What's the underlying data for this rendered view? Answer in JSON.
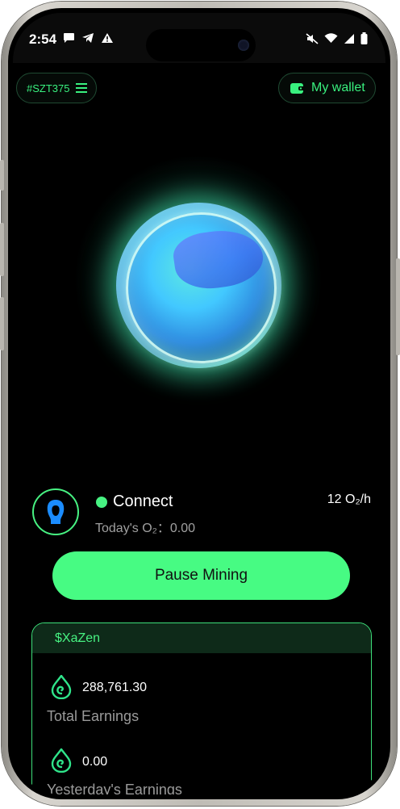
{
  "status_bar": {
    "time": "2:54"
  },
  "header": {
    "user_id": "#SZT375",
    "wallet_label": "My wallet"
  },
  "mining": {
    "status": "Connect",
    "today_label": "Today's O₂：",
    "today_value": "0.00",
    "rate": "12 O₂/h",
    "pause_label": "Pause Mining"
  },
  "earnings": {
    "token": "$XaZen",
    "total_value": "288,761.30",
    "total_label": "Total Earnings",
    "yesterday_value": "0.00",
    "yesterday_label": "Yesterday's Earnings"
  },
  "colors": {
    "accent": "#47f282",
    "button": "#47fb83",
    "background": "#000000"
  },
  "icons": [
    "message-icon",
    "telegram-icon",
    "warning-icon",
    "mute-icon",
    "wifi-icon",
    "signal-icon",
    "battery-icon",
    "menu-icon",
    "wallet-icon",
    "avatar-icon",
    "drop-swirl-icon"
  ]
}
